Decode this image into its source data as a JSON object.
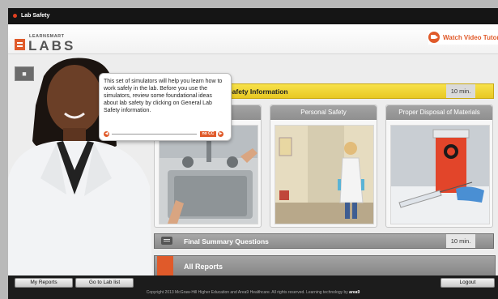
{
  "title_bar": {
    "title": "Lab Safety"
  },
  "header": {
    "logo_small": "LEARNSMART",
    "logo_big": "LABS",
    "watch_label": "Watch Video Tutorial"
  },
  "tooltip": {
    "text": "This set of simulators will help you learn how to work safely in the lab. Before you use the simulators, review some foundational ideas about lab safety by clicking on General Lab Safety information.",
    "cc_label": "no CC"
  },
  "sections": {
    "general": {
      "label": "Safety Information",
      "minutes": "10 min."
    },
    "cards": [
      {
        "label": "cedure"
      },
      {
        "label": "Personal Safety"
      },
      {
        "label": "Proper Disposal of Materials"
      }
    ],
    "final": {
      "label": "Final Summary Questions",
      "minutes": "10 min."
    },
    "reports": {
      "label": "All Reports"
    }
  },
  "footer": {
    "my_reports": "My Reports",
    "lab_list": "Go to Lab list",
    "logout": "Logout",
    "copyright": "Copyright 2013 McGraw-Hill Higher Education and Area9 Healthcare. All rights reserved. Learning technology by",
    "brand": "area9"
  }
}
